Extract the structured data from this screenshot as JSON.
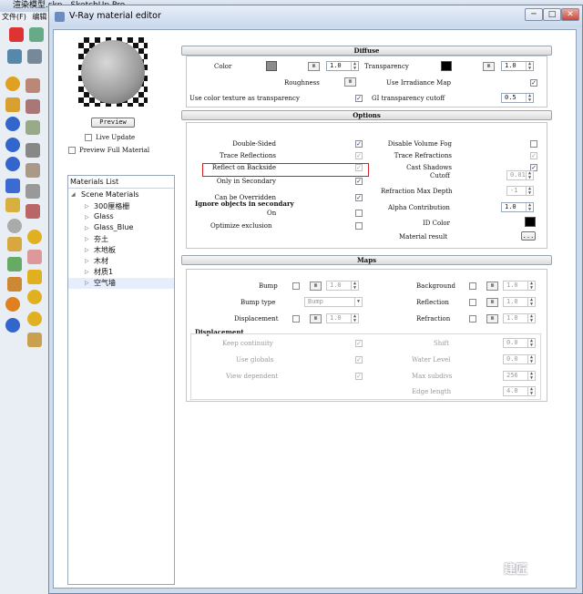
{
  "sketchup": {
    "title": "渲染模型.skp - SketchUp Pro",
    "menu": [
      "文件(F)",
      "编辑"
    ]
  },
  "window": {
    "title": "V-Ray material editor",
    "minimize": "─",
    "maximize": "□",
    "close": "✕"
  },
  "preview": {
    "button": "Preview",
    "live_update": "Live Update",
    "live_update_checked": false,
    "full_material": "Preview Full Material",
    "full_material_checked": false
  },
  "materials_list": {
    "header": "Materials List",
    "root": "Scene Materials",
    "items": [
      "300厘格栅",
      "Glass",
      "Glass_Blue",
      "夯土",
      "木地板",
      "木材",
      "材质1",
      "空气墙"
    ],
    "selected": "空气墙"
  },
  "diffuse": {
    "header": "Diffuse",
    "color_label": "Color",
    "color_value": "#8c8c8c",
    "m": "m",
    "color_amount": "1.0",
    "transparency_label": "Transparency",
    "transparency_value": "#000000",
    "transparency_amount": "1.0",
    "roughness_label": "Roughness",
    "use_irradiance_label": "Use Irradiance Map",
    "use_irradiance_checked": true,
    "use_color_texture_label": "Use color texture as transparency",
    "use_color_texture_checked": true,
    "gi_cutoff_label": "GI transparency cutoff",
    "gi_cutoff_value": "0.5"
  },
  "options": {
    "header": "Options",
    "left": [
      {
        "label": "Double-Sided",
        "checked": true,
        "disabled": false
      },
      {
        "label": "Trace Reflections",
        "checked": true,
        "disabled": true
      },
      {
        "label": "Reflect on Backside",
        "checked": true,
        "disabled": true
      },
      {
        "label": "Only in Secondary",
        "checked": true,
        "disabled": false
      },
      {
        "label": "Can be Overridden",
        "checked": true,
        "disabled": false
      }
    ],
    "ignore_label": "Ignore objects in secondary",
    "on_label": "On",
    "on_checked": false,
    "optimize_label": "Optimize exclusion",
    "optimize_checked": false,
    "right_checks": [
      {
        "label": "Disable Volume Fog",
        "checked": false,
        "disabled": false
      },
      {
        "label": "Trace Refractions",
        "checked": true,
        "disabled": true
      },
      {
        "label": "Cast Shadows",
        "checked": true,
        "disabled": false
      }
    ],
    "cutoff_label": "Cutoff",
    "cutoff_value": "0.01",
    "refraction_depth_label": "Refraction Max Depth",
    "refraction_depth_value": "-1",
    "alpha_label": "Alpha Contribution",
    "alpha_value": "1.0",
    "id_color_label": "ID Color",
    "id_color_value": "#000000",
    "material_result_label": "Material result",
    "material_result_button": "..."
  },
  "maps": {
    "header": "Maps",
    "bump_label": "Bump",
    "bump_amount": "1.0",
    "bump_type_label": "Bump type",
    "bump_type_value": "Bump",
    "displacement_label": "Displacement",
    "displacement_amount": "1.0",
    "background_label": "Background",
    "background_amount": "1.0",
    "reflection_label": "Reflection",
    "reflection_amount": "1.0",
    "refraction_label": "Refraction",
    "refraction_amount": "1.0",
    "disp_group_label": "Displacement",
    "keep_continuity": "Keep continuity",
    "use_globals": "Use globals",
    "view_dependent": "View dependent",
    "shift_label": "Shift",
    "shift_value": "0.0",
    "water_level_label": "Water Level",
    "water_level_value": "0.0",
    "max_subdivs_label": "Max subdivs",
    "max_subdivs_value": "256",
    "edge_length_label": "Edge length",
    "edge_length_value": "4.0"
  },
  "highlight_color": "#d42020",
  "watermark": "建匠"
}
